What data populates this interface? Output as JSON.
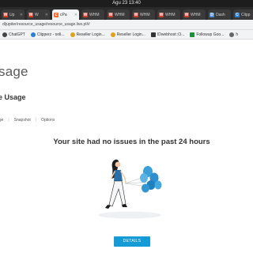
{
  "system_bar": {
    "clock": "Agu 23  13:40"
  },
  "tabs": [
    {
      "label": "Up",
      "icon": "whm-icon"
    },
    {
      "label": "W",
      "icon": "whm-icon"
    },
    {
      "label": "cPa",
      "icon": "cpanel-icon",
      "active": true
    },
    {
      "label": "WHM",
      "icon": "whm-icon"
    },
    {
      "label": "WHM",
      "icon": "whm-icon"
    },
    {
      "label": "WHM",
      "icon": "whm-icon"
    },
    {
      "label": "WHM",
      "icon": "whm-icon"
    },
    {
      "label": "WHM",
      "icon": "whm-icon"
    },
    {
      "label": "Dash",
      "icon": "dash-icon"
    },
    {
      "label": "Clipp",
      "icon": "clipperz-icon"
    }
  ],
  "address_bar": {
    "url": "d/jupiter/resource_usage/resource_usage.live.pl#/"
  },
  "bookmarks": [
    {
      "label": "ChatGPT",
      "icon": "chatgpt-icon",
      "color": "#444444"
    },
    {
      "label": "Clipperz - onli...",
      "icon": "clipperz-icon",
      "color": "#2a7fd4"
    },
    {
      "label": "Reseller Login...",
      "icon": "bookmark-icon",
      "color": "#e0a21a"
    },
    {
      "label": "Reseller Login...",
      "icon": "bookmark-icon",
      "color": "#e0a21a"
    },
    {
      "label": "IDwebhost::O...",
      "icon": "idwebhost-icon",
      "color": "#333333"
    },
    {
      "label": "Followup Goo...",
      "icon": "sheets-icon",
      "color": "#1e8e3e"
    },
    {
      "label": "h",
      "icon": "bookmark-icon",
      "color": "#666666"
    }
  ],
  "page": {
    "heading": "sage",
    "section_heading": "e Usage",
    "subtabs": [
      "age",
      "Snapshot",
      "Options"
    ],
    "message": "Your site had no issues in the past 24 hours",
    "details_button": "DETAILS"
  },
  "colors": {
    "accent": "#179bd7",
    "balloon": "#3aa0d8",
    "shirt": "#2b6fa8"
  }
}
